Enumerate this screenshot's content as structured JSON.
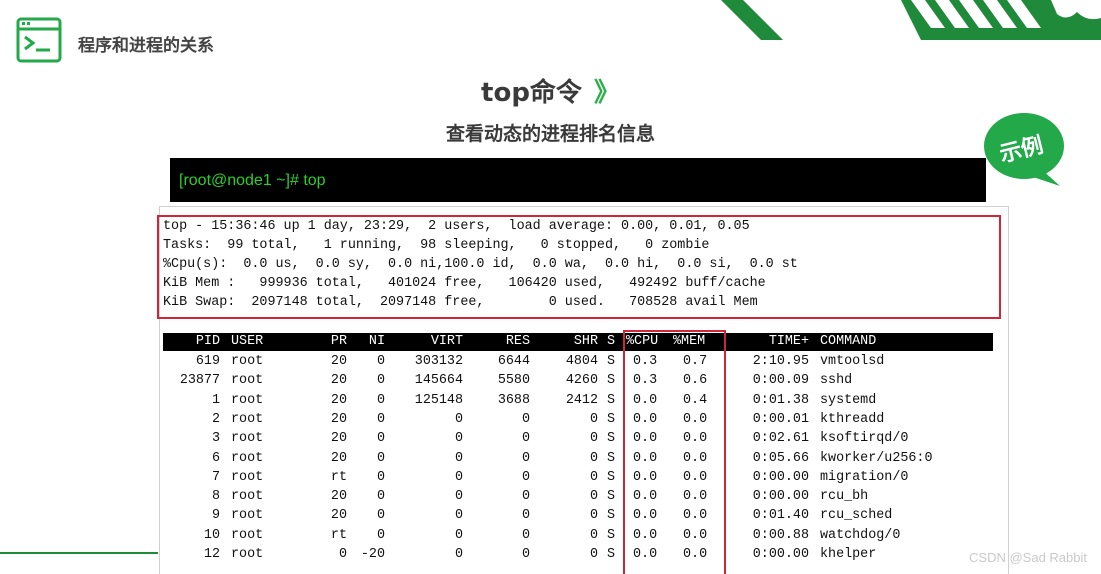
{
  "header": {
    "title": "程序和进程的关系",
    "icon": "terminal-prompt-icon",
    "accent_color": "#23a84a"
  },
  "slide": {
    "title": "top命令",
    "chevron": "》",
    "subtitle": "查看动态的进程排名信息",
    "badge": "示例"
  },
  "command": {
    "text": "[root@node1 ~]# top"
  },
  "summary": [
    "top - 15:36:46 up 1 day, 23:29,  2 users,  load average: 0.00, 0.01, 0.05",
    "Tasks:  99 total,   1 running,  98 sleeping,   0 stopped,   0 zombie",
    "%Cpu(s):  0.0 us,  0.0 sy,  0.0 ni,100.0 id,  0.0 wa,  0.0 hi,  0.0 si,  0.0 st",
    "KiB Mem :   999936 total,   401024 free,   106420 used,   492492 buff/cache",
    "KiB Swap:  2097148 total,  2097148 free,        0 used.   708528 avail Mem"
  ],
  "table": {
    "headers": [
      "PID",
      "USER",
      "PR",
      "NI",
      "VIRT",
      "RES",
      "SHR",
      "S",
      "%CPU",
      "%MEM",
      "TIME+",
      "COMMAND"
    ],
    "rows": [
      [
        "619",
        "root",
        "20",
        "0",
        "303132",
        "6644",
        "4804",
        "S",
        "0.3",
        "0.7",
        "2:10.95",
        "vmtoolsd"
      ],
      [
        "23877",
        "root",
        "20",
        "0",
        "145664",
        "5580",
        "4260",
        "S",
        "0.3",
        "0.6",
        "0:00.09",
        "sshd"
      ],
      [
        "1",
        "root",
        "20",
        "0",
        "125148",
        "3688",
        "2412",
        "S",
        "0.0",
        "0.4",
        "0:01.38",
        "systemd"
      ],
      [
        "2",
        "root",
        "20",
        "0",
        "0",
        "0",
        "0",
        "S",
        "0.0",
        "0.0",
        "0:00.01",
        "kthreadd"
      ],
      [
        "3",
        "root",
        "20",
        "0",
        "0",
        "0",
        "0",
        "S",
        "0.0",
        "0.0",
        "0:02.61",
        "ksoftirqd/0"
      ],
      [
        "6",
        "root",
        "20",
        "0",
        "0",
        "0",
        "0",
        "S",
        "0.0",
        "0.0",
        "0:05.66",
        "kworker/u256:0"
      ],
      [
        "7",
        "root",
        "rt",
        "0",
        "0",
        "0",
        "0",
        "S",
        "0.0",
        "0.0",
        "0:00.00",
        "migration/0"
      ],
      [
        "8",
        "root",
        "20",
        "0",
        "0",
        "0",
        "0",
        "S",
        "0.0",
        "0.0",
        "0:00.00",
        "rcu_bh"
      ],
      [
        "9",
        "root",
        "20",
        "0",
        "0",
        "0",
        "0",
        "S",
        "0.0",
        "0.0",
        "0:01.40",
        "rcu_sched"
      ],
      [
        "10",
        "root",
        "rt",
        "0",
        "0",
        "0",
        "0",
        "S",
        "0.0",
        "0.0",
        "0:00.88",
        "watchdog/0"
      ],
      [
        "12",
        "root",
        "0",
        "-20",
        "0",
        "0",
        "0",
        "S",
        "0.0",
        "0.0",
        "0:00.00",
        "khelper"
      ]
    ]
  },
  "watermark": "CSDN @Sad Rabbit",
  "colors": {
    "highlight": "#d0253a",
    "terminal_green": "#2ad02a",
    "brand_green": "#23a84a"
  }
}
